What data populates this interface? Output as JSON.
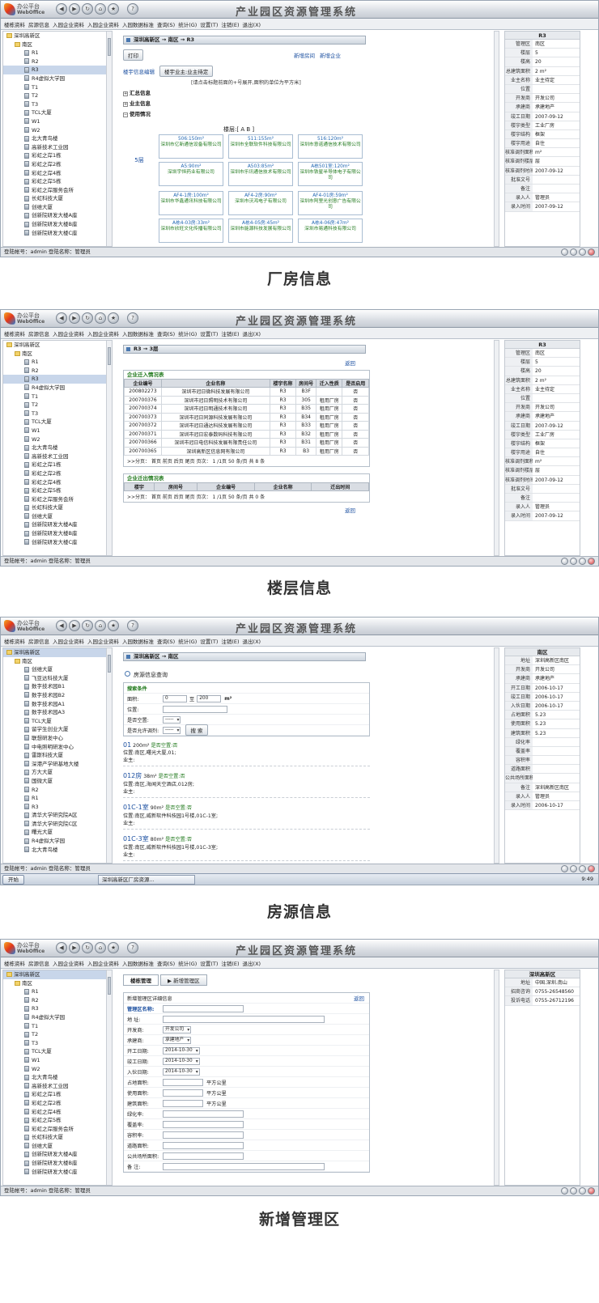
{
  "window": {
    "logo_title": "办公平台",
    "logo_sub": "WebOffice",
    "app_title": "产业园区资源管理系统",
    "menu": [
      "楼栋资料",
      "房源信息",
      "入园企业资料",
      "入园企业资料",
      "入园数据标准",
      "查询(S)",
      "统计(G)",
      "设置(T)",
      "注销(E)",
      "退出(X)"
    ],
    "status": "登陆帐号：admin  登陆名称：管理员"
  },
  "tree": {
    "root": "深圳高新区",
    "area": "南区",
    "buildings": [
      "R1",
      "R2",
      "R3",
      "R4虚拟大学园",
      "T1",
      "T2",
      "T3",
      "TCL大厦",
      "W1",
      "W2",
      "北大青鸟楼",
      "高新技术工业园",
      "彩虹之岸1栋",
      "彩虹之岸2栋",
      "彩虹之岸4栋",
      "彩虹之岸5栋",
      "彩虹之岸服务会所",
      "长虹科技大厦",
      "创维大厦",
      "创新院研发大楼A座",
      "创新院研发大楼B座",
      "创新院研发大楼C座"
    ],
    "buildings3": [
      "创维大厦",
      "飞亚达科技大厦",
      "数字技术园B1",
      "数字技术园B2",
      "数字技术园A1",
      "数字技术园A3",
      "TCL大厦",
      "留学生创业大厦",
      "联想研发中心",
      "中电照明研发中心",
      "雷斯科技大厦",
      "深港产学研基地大楼",
      "方大大厦",
      "国微大厦",
      "R2",
      "R1",
      "R3",
      "清华大学研究院A区",
      "清华大学研究院C区",
      "曙光大厦",
      "R4虚拟大学园",
      "北大青鸟楼"
    ]
  },
  "side": {
    "header": "R3",
    "rows": [
      {
        "k": "管理区",
        "v": "南区"
      },
      {
        "k": "楼层",
        "v": "5"
      },
      {
        "k": "楼高",
        "v": "20"
      },
      {
        "k": "总建筑面积",
        "v": "2 m²"
      },
      {
        "k": "业主名称",
        "v": "业主待定"
      },
      {
        "k": "位置",
        "v": ""
      },
      {
        "k": "开发商",
        "v": "开发公司"
      },
      {
        "k": "承建商",
        "v": "承建地产"
      },
      {
        "k": "竣工日期",
        "v": "2007-09-12"
      },
      {
        "k": "楼宇类型",
        "v": "工业厂房"
      },
      {
        "k": "楼宇结构",
        "v": "框架"
      },
      {
        "k": "楼宇用途",
        "v": "自住"
      },
      {
        "k": "核准调剂面积",
        "v": "m²"
      },
      {
        "k": "核准调剂楼层",
        "v": "层"
      },
      {
        "k": "核准调剂时间",
        "v": "2007-09-12"
      },
      {
        "k": "批准文号",
        "v": ""
      },
      {
        "k": "备注",
        "v": ""
      },
      {
        "k": "录入人",
        "v": "管理员"
      },
      {
        "k": "录入时间",
        "v": "2007-09-12"
      }
    ]
  },
  "side3": {
    "header": "南区",
    "rows": [
      {
        "k": "地址",
        "v": "深圳高新区南区"
      },
      {
        "k": "开发商",
        "v": "开发公司"
      },
      {
        "k": "承建商",
        "v": "承建地产"
      },
      {
        "k": "开工日期",
        "v": "2006-10-17"
      },
      {
        "k": "竣工日期",
        "v": "2006-10-17"
      },
      {
        "k": "入伙日期",
        "v": "2006-10-17"
      },
      {
        "k": "占地面积",
        "v": "5.23"
      },
      {
        "k": "使用面积",
        "v": "5.23"
      },
      {
        "k": "建筑面积",
        "v": "5.23"
      },
      {
        "k": "绿化率",
        "v": ""
      },
      {
        "k": "覆盖率",
        "v": ""
      },
      {
        "k": "容积率",
        "v": ""
      },
      {
        "k": "道路面积",
        "v": ""
      },
      {
        "k": "公共场所面积",
        "v": ""
      },
      {
        "k": "备注",
        "v": "深圳高新区南区"
      },
      {
        "k": "录入人",
        "v": "管理员"
      },
      {
        "k": "录入时间",
        "v": "2006-10-17"
      }
    ]
  },
  "side4": {
    "header": "深圳高新区",
    "rows": [
      {
        "k": "地址",
        "v": "中国.深圳.南山"
      },
      {
        "k": "招商咨询",
        "v": "0755-26548560"
      },
      {
        "k": "投诉电话",
        "v": "0755-26712196"
      }
    ]
  },
  "s1": {
    "caption": "厂房信息",
    "crumb": "深圳高新区 → 南区 → R3",
    "print": "打印",
    "add_room": "新增房间",
    "add_company": "新增企业",
    "edit_bld": "楼宇信息编辑",
    "owner": "楼宇业主:业主待定",
    "hint": "[请点击标题前面的+号展开,面积的单位为平方米]",
    "sec1": "汇总信息",
    "sec2": "业主信息",
    "sec3": "使用情况",
    "floor_sel": "楼层:[ A B ]",
    "floor": "5层",
    "units": [
      {
        "t": "506:150m²",
        "c": "深圳市亿新通信设备有限公司"
      },
      {
        "t": "511:155m²",
        "c": "深圳市全联软件科技有限公司"
      },
      {
        "t": "516:120m²",
        "c": "深圳市意诺通信技术有限公司"
      },
      {
        "t": "A5:90m²",
        "c": "深圳宇恒药业有限公司"
      },
      {
        "t": "A503:85m²",
        "c": "深圳市乐讯通信技术有限公司"
      },
      {
        "t": "A栋501室:120m²",
        "c": "深圳市铁星半导体电子有限公司"
      },
      {
        "t": "AF4-1房:100m²",
        "c": "深圳市华鑫通讯科技有限公司"
      },
      {
        "t": "AF4-2房:90m²",
        "c": "深圳市沃鸿电子有限公司"
      },
      {
        "t": "AF4-01房:59m²",
        "c": "深圳市阿里光创意广告有限公司"
      },
      {
        "t": "A栋4-03房:33m²",
        "c": "深圳市欣旺文化传播有限公司"
      },
      {
        "t": "A栋4-05房:45m²",
        "c": "深圳市能源科技发展有限公司"
      },
      {
        "t": "A栋4-06房:47m²",
        "c": "深圳市易通科技有限公司"
      }
    ]
  },
  "s2": {
    "caption": "楼层信息",
    "crumb": "R3 → 3层",
    "back": "返回",
    "in_title": "企业迁入情况表",
    "in_cols": [
      "企业编号",
      "企业名称",
      "楼宇名称",
      "房间号",
      "迁入性质",
      "是否启用"
    ],
    "in_rows": [
      [
        "200802273",
        "深圳市冠日微科技发展有限公司",
        "R3",
        "B3F",
        "",
        "否"
      ],
      [
        "200700376",
        "深圳市冠日照明技术有限公司",
        "R3",
        "305",
        "租用厂房",
        "否"
      ],
      [
        "200700374",
        "深圳市冠日明通技术有限公司",
        "R3",
        "B35",
        "租用厂房",
        "否"
      ],
      [
        "200700373",
        "深圳市冠日同源科技发展有限公司",
        "R3",
        "B34",
        "租用厂房",
        "否"
      ],
      [
        "200700372",
        "深圳市冠日通达科技发展有限公司",
        "R3",
        "B33",
        "租用厂房",
        "否"
      ],
      [
        "200700371",
        "深圳市冠日宏泰数码科技有限公司",
        "R3",
        "B32",
        "租用厂房",
        "否"
      ],
      [
        "200700366",
        "深圳市冠日电信科技发展有限责任公司",
        "R3",
        "B31",
        "租用厂房",
        "否"
      ],
      [
        "200700365",
        "深圳高新区信息网有限公司",
        "R3",
        "B3",
        "租用厂房",
        "否"
      ]
    ],
    "pager1": ">>分页： 首页 前页 后页 尾页   页次： 1 /1页 50 条/页 共 8 条",
    "out_title": "企业迁出情况表",
    "out_cols": [
      "楼宇",
      "房间号",
      "企业编号",
      "企业名称",
      "迁出时间"
    ],
    "pager2": ">>分页： 首页 前页 后页 尾页   页次： 1 /1页 50 条/页 共 0 条"
  },
  "s3": {
    "caption": "房源信息",
    "crumb": "深圳高新区 → 南区",
    "search_title": "房源信息查询",
    "cond": "搜索条件",
    "area_lbl": "面积:",
    "area_from": "0",
    "area_to": "200",
    "area_to_lbl": "至",
    "area_unit": "m²",
    "pos_lbl": "位置:",
    "empty_lbl": "是否空置:",
    "adjust_lbl": "是否允许调剂:",
    "search_btn": "搜 索",
    "results": [
      {
        "t": "01",
        "a": "200m²",
        "s": "是否空置:否",
        "p": "位置:南区,曙光大厦,01;",
        "o": "业主:"
      },
      {
        "t": "012房",
        "a": "38m²",
        "s": "是否空置:否",
        "p": "位置:南区,海闻天空酒店,012房;",
        "o": "业主:"
      },
      {
        "t": "01C-1室",
        "a": "90m²",
        "s": "是否空置:否",
        "p": "位置:南区,威新软件科技园1号楼,01C-1室;",
        "o": "业主:"
      },
      {
        "t": "01C-3室",
        "a": "80m²",
        "s": "是否空置:否",
        "p": "位置:南区,威新软件科技园1号楼,01C-3室;",
        "o": "业主:"
      }
    ],
    "taskbar_start": "开始",
    "taskbar_item": "深圳高新区厂房资源...",
    "clock": "9:49"
  },
  "s4": {
    "caption": "新增管理区",
    "tab1": "楼栋管理",
    "tab2": "新增管理区",
    "form_title": "新增管理区详细信息",
    "back": "返回",
    "fields": [
      "管理区名称:",
      "地 址:",
      "开发商:",
      "承建商:",
      "开工日期:",
      "竣工日期:",
      "入伙日期:",
      "占地面积:",
      "使用面积:",
      "建筑面积:",
      "绿化率:",
      "覆盖率:",
      "容积率:",
      "道路面积:",
      "公共场所面积:",
      "备 注:"
    ],
    "dev": "开发公司",
    "builder": "承建地产",
    "date": "2014-10-30",
    "unit": "平方公里"
  }
}
